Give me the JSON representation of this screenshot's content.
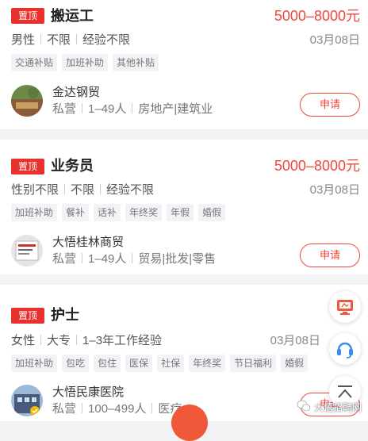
{
  "jobs": [
    {
      "badge": "置顶",
      "title": "搬运工",
      "salary": "5000–8000元",
      "requirements": [
        "男性",
        "不限",
        "经验不限"
      ],
      "date": "03月08日",
      "tags": [
        "交通补贴",
        "加班补助",
        "其他补贴"
      ],
      "company": {
        "name": "金达钢贸",
        "type": "私营",
        "size": "1–49人",
        "industry": "房地产|建筑业"
      },
      "apply_label": "申请"
    },
    {
      "badge": "置顶",
      "title": "业务员",
      "salary": "5000–8000元",
      "requirements": [
        "性别不限",
        "不限",
        "经验不限"
      ],
      "date": "03月08日",
      "tags": [
        "加班补助",
        "餐补",
        "话补",
        "年终奖",
        "年假",
        "婚假"
      ],
      "company": {
        "name": "大悟桂林商贸",
        "type": "私营",
        "size": "1–49人",
        "industry": "贸易|批发|零售"
      },
      "apply_label": "申请"
    },
    {
      "badge": "置顶",
      "title": "护士",
      "salary": "",
      "requirements": [
        "女性",
        "大专",
        "1–3年工作经验"
      ],
      "date": "03月08日",
      "tags": [
        "加班补助",
        "包吃",
        "包住",
        "医保",
        "社保",
        "年终奖",
        "节日福利",
        "婚假"
      ],
      "company": {
        "name": "大悟民康医院",
        "type": "私营",
        "size": "100–499人",
        "industry": "医疗"
      },
      "apply_label": "申请"
    }
  ],
  "watermark": "大悟招聘网",
  "icons": {
    "float_1": "computer-service-icon",
    "float_2": "headset-icon",
    "float_3": "back-to-top-icon"
  },
  "colors": {
    "accent": "#f0463c",
    "badge": "#e8302c",
    "float_icon": "#f05a3a",
    "headset": "#3a8ee6"
  }
}
